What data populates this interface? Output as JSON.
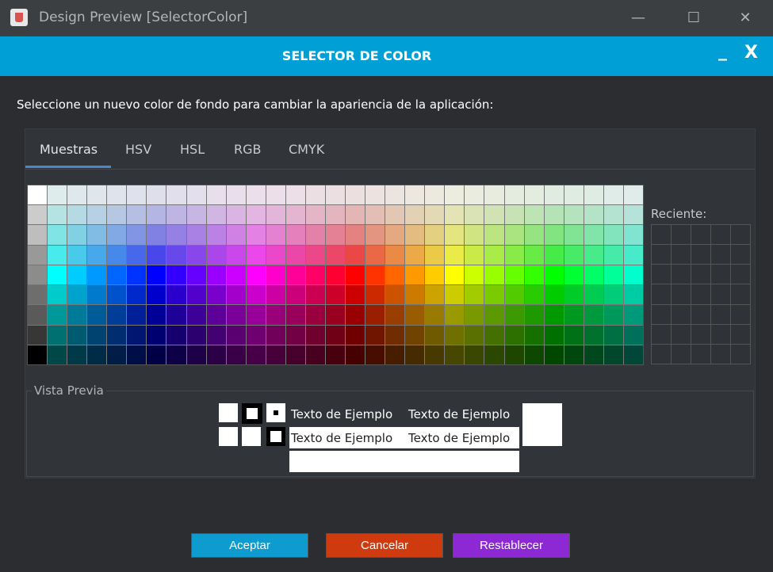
{
  "window": {
    "title": "Design Preview [SelectorColor]",
    "controls": [
      "minimize",
      "maximize",
      "close"
    ]
  },
  "header": {
    "title": "SELECTOR DE COLOR",
    "minimize_label": "_",
    "close_label": "X",
    "color": "#00a0d6"
  },
  "prompt": "Seleccione un nuevo color de fondo para cambiar la apariencia de la aplicación:",
  "tabs": [
    {
      "label": "Muestras",
      "selected": true
    },
    {
      "label": "HSV",
      "selected": false
    },
    {
      "label": "HSL",
      "selected": false
    },
    {
      "label": "RGB",
      "selected": false
    },
    {
      "label": "CMYK",
      "selected": false
    }
  ],
  "recent_label": "Reciente:",
  "preview": {
    "title": "Vista Previa",
    "sample_text": "Texto de Ejemplo"
  },
  "buttons": {
    "accept": {
      "label": "Aceptar",
      "color": "#0e9bd0"
    },
    "cancel": {
      "label": "Cancelar",
      "color": "#cf3a0e"
    },
    "reset": {
      "label": "Restablecer",
      "color": "#8c28d4"
    }
  }
}
